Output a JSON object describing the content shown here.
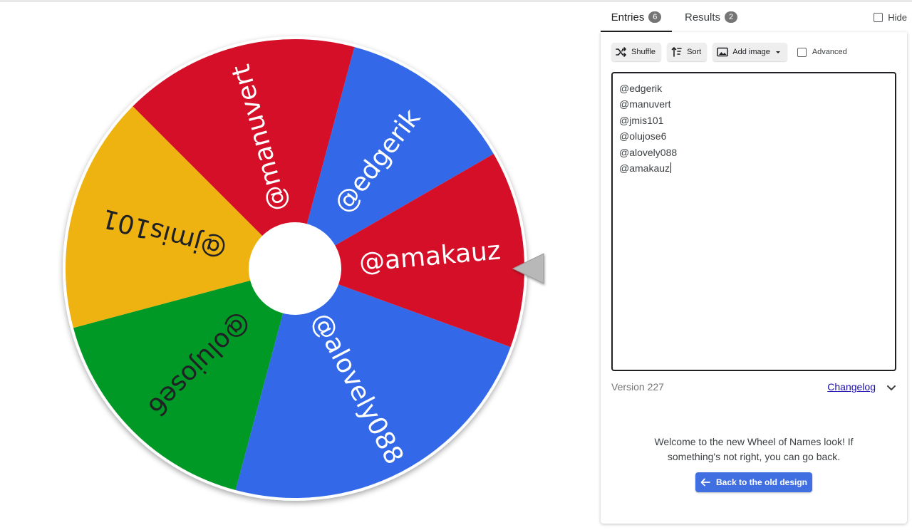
{
  "wheel": {
    "entries": [
      "@edgerik",
      "@manuvert",
      "@jmis101",
      "@olujose6",
      "@alovely088",
      "@amakauz"
    ],
    "colors": {
      "red": "#d40f27",
      "blue": "#3369e8",
      "yellow": "#eeb211",
      "green": "#009925"
    }
  },
  "tabs": {
    "entries_label": "Entries",
    "entries_count": "6",
    "results_label": "Results",
    "results_count": "2",
    "hide_label": "Hide"
  },
  "toolbar": {
    "shuffle_label": "Shuffle",
    "sort_label": "Sort",
    "add_image_label": "Add image",
    "advanced_label": "Advanced"
  },
  "footer": {
    "version_label": "Version 227",
    "changelog_label": "Changelog"
  },
  "welcome": {
    "line1": "Welcome to the new Wheel of Names look! If",
    "line2": "something's not right, you can go back.",
    "back_button_label": "Back to the old design"
  }
}
